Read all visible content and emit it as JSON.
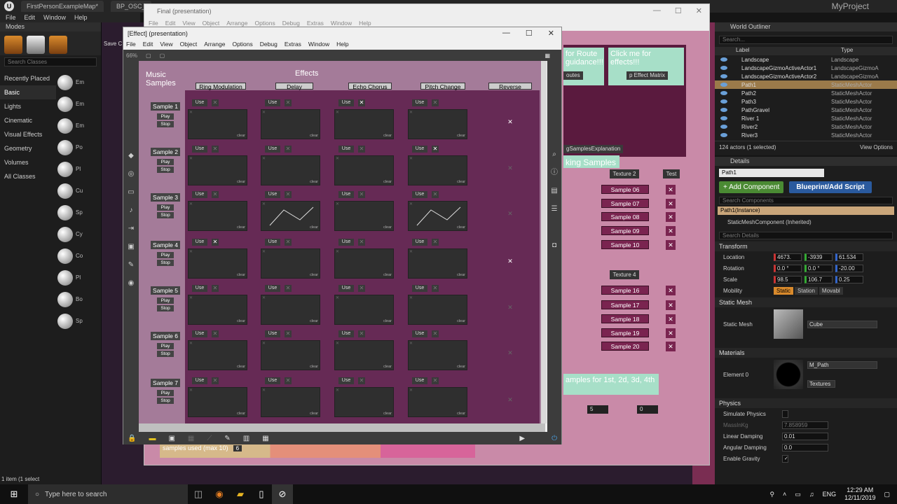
{
  "ue": {
    "tabs": [
      "FirstPersonExampleMap*",
      "BP_OSC_"
    ],
    "project": "MyProject",
    "menu": [
      "File",
      "Edit",
      "Window",
      "Help"
    ],
    "modes_title": "Modes",
    "search_classes": "Search Classes",
    "categories": [
      "Recently Placed",
      "Basic",
      "Lights",
      "Cinematic",
      "Visual Effects",
      "Geometry",
      "Volumes",
      "All Classes"
    ],
    "selected_category": "Basic",
    "placeables": [
      "Em",
      "Em",
      "Em",
      "Po",
      "Pl",
      "Cu",
      "Sp",
      "Cy",
      "Co",
      "Pl",
      "Bo",
      "Sp"
    ],
    "save_label": "Save C",
    "items_selected": "1 item (1 select"
  },
  "outliner": {
    "title": "World Outliner",
    "search": "Search...",
    "col_label": "Label",
    "col_type": "Type",
    "rows": [
      {
        "name": "Landscape",
        "type": "Landscape"
      },
      {
        "name": "LandscapeGizmoActiveActor1",
        "type": "LandscapeGizmoA"
      },
      {
        "name": "LandscapeGizmoActiveActor2",
        "type": "LandscapeGizmoA"
      },
      {
        "name": "Path1",
        "type": "StaticMeshActor"
      },
      {
        "name": "Path2",
        "type": "StaticMeshActor"
      },
      {
        "name": "Path3",
        "type": "StaticMeshActor"
      },
      {
        "name": "PathGravel",
        "type": "StaticMeshActor"
      },
      {
        "name": "River 1",
        "type": "StaticMeshActor"
      },
      {
        "name": "River2",
        "type": "StaticMeshActor"
      },
      {
        "name": "River3",
        "type": "StaticMeshActor"
      }
    ],
    "selected_row": 3,
    "footer": "124 actors (1 selected)",
    "view_options": "View Options"
  },
  "details": {
    "title": "Details",
    "name": "Path1",
    "add_component": "+ Add Component",
    "blueprint": "Blueprint/Add Script",
    "search_components": "Search Components",
    "instance": "Path1(Instance)",
    "component": "StaticMeshComponent (Inherited)",
    "search_details": "Search Details",
    "transform": "Transform",
    "location": {
      "label": "Location",
      "x": "4673.",
      "y": "-3939",
      "z": "61.534"
    },
    "rotation": {
      "label": "Rotation",
      "x": "0.0 °",
      "y": "0.0 °",
      "z": "-20.00"
    },
    "scale": {
      "label": "Scale",
      "x": "98.5",
      "y": "106.7",
      "z": "0.25"
    },
    "mobility": {
      "label": "Mobility",
      "options": [
        "Static",
        "Station",
        "Movabl"
      ]
    },
    "static_mesh_section": "Static Mesh",
    "static_mesh_label": "Static Mesh",
    "static_mesh_value": "Cube",
    "materials_section": "Materials",
    "element0_label": "Element 0",
    "element0_value": "M_Path",
    "textures_label": "Textures",
    "physics_section": "Physics",
    "simulate_physics": "Simulate Physics",
    "mass_label": "MassInKg",
    "mass_value": "7.858959",
    "linear_damping_label": "Linear Damping",
    "linear_damping": "0.01",
    "angular_damping_label": "Angular Damping",
    "angular_damping": "0.0",
    "enable_gravity": "Enable Gravity"
  },
  "final_window": {
    "title": "Final (presentation)",
    "menu": [
      "File",
      "Edit",
      "View",
      "Object",
      "Arrange",
      "Options",
      "Debug",
      "Extras",
      "Window",
      "Help"
    ],
    "route_text": "for Route guidance!!!",
    "route_btn": "outes",
    "effects_text": "Click me for effects!!!",
    "effects_btn": "p Effect Matrix",
    "explanation_btn": "gSamplesExplanation",
    "king_samples": "king Samples",
    "texture2": "Texture 2",
    "test": "Test",
    "samples_a": [
      "Sample 06",
      "Sample 07",
      "Sample 08",
      "Sample 09",
      "Sample 10"
    ],
    "texture4": "Texture 4",
    "samples_b": [
      "Sample 16",
      "Sample 17",
      "Sample 18",
      "Sample 19",
      "Sample 20"
    ],
    "bottom_text": "amples for 1st, 2d, 3d, 4th",
    "num1": "5",
    "num2": "0",
    "samples_used": "samples used (max 10)",
    "samples_used_val": "6"
  },
  "effect_window": {
    "title": "[Effect] (presentation)",
    "menu": [
      "File",
      "Edit",
      "View",
      "Object",
      "Arrange",
      "Options",
      "Debug",
      "Extras",
      "Window",
      "Help"
    ],
    "zoom": "66%",
    "music_samples": "Music Samples",
    "effects": "Effects",
    "fx_columns": [
      "Ring Modulation",
      "Delay",
      "Echo Chorus",
      "Pitch Change",
      "Reverse"
    ],
    "samples": [
      "Sample 1",
      "Sample 2",
      "Sample 3",
      "Sample 4",
      "Sample 5",
      "Sample 6",
      "Sample 7"
    ],
    "play": "Play",
    "stop": "Stop",
    "use": "Use",
    "clear": "clear",
    "use_checked": [
      [
        false,
        false,
        true,
        false
      ],
      [
        false,
        false,
        false,
        true
      ],
      [
        false,
        false,
        false,
        false
      ],
      [
        true,
        false,
        false,
        false
      ],
      [
        false,
        false,
        false,
        false
      ],
      [
        false,
        false,
        false,
        false
      ],
      [
        false,
        false,
        false,
        false
      ]
    ],
    "reverse_checked": [
      true,
      false,
      false,
      true,
      false,
      false,
      false
    ],
    "curves": [
      [
        2,
        1
      ],
      [
        2,
        3
      ]
    ]
  },
  "taskbar": {
    "search": "Type here to search",
    "lang": "ENG",
    "time": "12:29 AM",
    "date": "12/11/2019"
  }
}
